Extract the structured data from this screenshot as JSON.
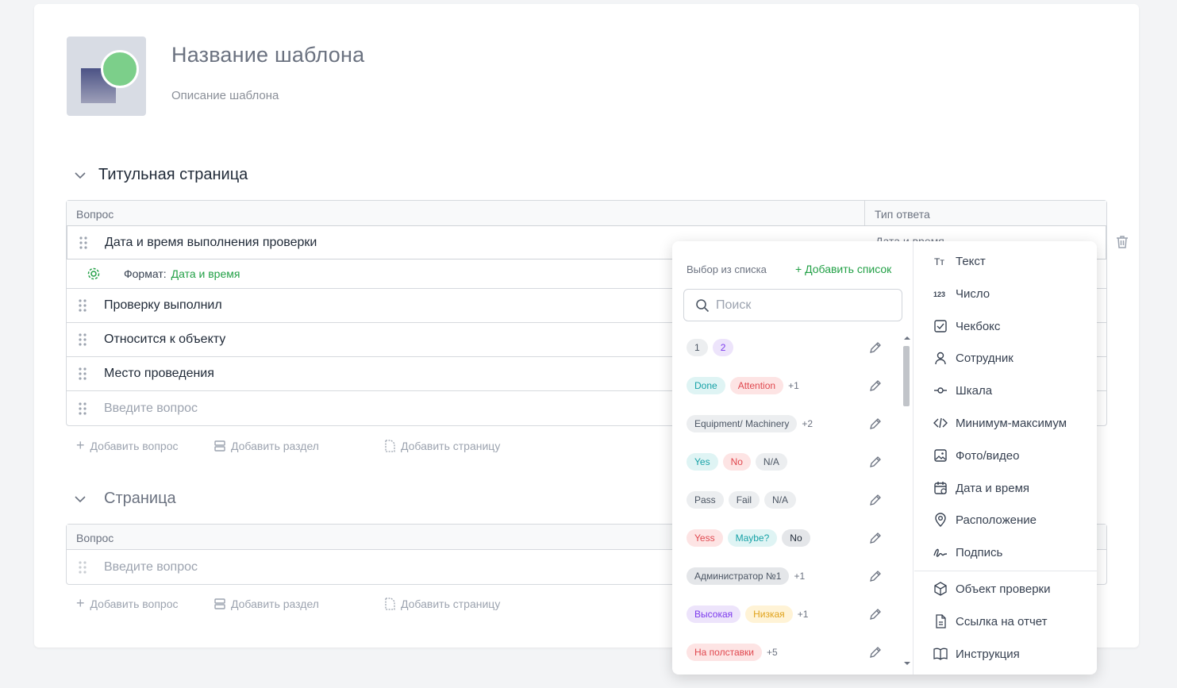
{
  "template": {
    "title": "Название шаблона",
    "description": "Описание шаблона"
  },
  "sections": [
    {
      "title": "Титульная страница",
      "col_question": "Вопрос",
      "col_type": "Тип ответа",
      "rows": [
        "Дата и время выполнения проверки",
        "Проверку выполнил",
        "Относится к объекту",
        "Место проведения"
      ],
      "placeholder": "Введите вопрос",
      "format_label": "Формат:",
      "format_value": "Дата и время",
      "under_text": "Дата и время"
    },
    {
      "title": "Страница",
      "col_question": "Вопрос",
      "placeholder": "Введите вопрос"
    }
  ],
  "actions": {
    "add_question": "Добавить вопрос",
    "add_section": "Добавить раздел",
    "add_page": "Добавить страницу"
  },
  "dropdown": {
    "list_header": "Выбор из списка",
    "add_list": "+ Добавить список",
    "search_placeholder": "Поиск",
    "lists": [
      {
        "chips": [
          {
            "t": "1",
            "bg": "#eceef0",
            "fg": "#4b5563"
          },
          {
            "t": "2",
            "bg": "#ede4fb",
            "fg": "#7c3aed"
          }
        ],
        "more": ""
      },
      {
        "chips": [
          {
            "t": "Done",
            "bg": "#dff4f4",
            "fg": "#17a2a7"
          },
          {
            "t": "Attention",
            "bg": "#fde4e4",
            "fg": "#e0484f"
          }
        ],
        "more": "+1"
      },
      {
        "chips": [
          {
            "t": "Equipment/ Machinery",
            "bg": "#eceef0",
            "fg": "#4b5563"
          }
        ],
        "more": "+2"
      },
      {
        "chips": [
          {
            "t": "Yes",
            "bg": "#dff4f4",
            "fg": "#17a2a7"
          },
          {
            "t": "No",
            "bg": "#fde4e4",
            "fg": "#e0484f"
          },
          {
            "t": "N/A",
            "bg": "#eceef0",
            "fg": "#4b5563"
          }
        ],
        "more": ""
      },
      {
        "chips": [
          {
            "t": "Pass",
            "bg": "#eceef0",
            "fg": "#4b5563"
          },
          {
            "t": "Fail",
            "bg": "#eceef0",
            "fg": "#4b5563"
          },
          {
            "t": "N/A",
            "bg": "#eceef0",
            "fg": "#4b5563"
          }
        ],
        "more": ""
      },
      {
        "chips": [
          {
            "t": "Yess",
            "bg": "#fde4e4",
            "fg": "#e0484f"
          },
          {
            "t": "Maybe?",
            "bg": "#dff4f4",
            "fg": "#17a2a7"
          },
          {
            "t": "No",
            "bg": "#e4e6e9",
            "fg": "#1f2937"
          }
        ],
        "more": ""
      },
      {
        "chips": [
          {
            "t": "Администратор №1",
            "bg": "#e4e6e9",
            "fg": "#4b5563"
          }
        ],
        "more": "+1"
      },
      {
        "chips": [
          {
            "t": "Высокая",
            "bg": "#ede4fb",
            "fg": "#7c3aed"
          },
          {
            "t": "Низкая",
            "bg": "#fff3d6",
            "fg": "#e0a21a"
          }
        ],
        "more": "+1"
      },
      {
        "chips": [
          {
            "t": "На полставки",
            "bg": "#fde4e4",
            "fg": "#e0484f"
          }
        ],
        "more": "+5"
      }
    ],
    "types": [
      {
        "label": "Текст",
        "icon": "text-icon"
      },
      {
        "label": "Число",
        "icon": "number-icon"
      },
      {
        "label": "Чекбокс",
        "icon": "checkbox-icon"
      },
      {
        "label": "Сотрудник",
        "icon": "user-icon"
      },
      {
        "label": "Шкала",
        "icon": "slider-icon"
      },
      {
        "label": "Минимум-максимум",
        "icon": "code-icon"
      },
      {
        "label": "Фото/видео",
        "icon": "image-icon"
      },
      {
        "label": "Дата и время",
        "icon": "calendar-icon"
      },
      {
        "label": "Расположение",
        "icon": "location-icon"
      },
      {
        "label": "Подпись",
        "icon": "signature-icon"
      },
      {
        "label": "Объект проверки",
        "icon": "box-icon"
      },
      {
        "label": "Ссылка на отчет",
        "icon": "document-icon"
      },
      {
        "label": "Инструкция",
        "icon": "book-icon"
      }
    ]
  },
  "colors": {
    "accent": "#22a046"
  }
}
